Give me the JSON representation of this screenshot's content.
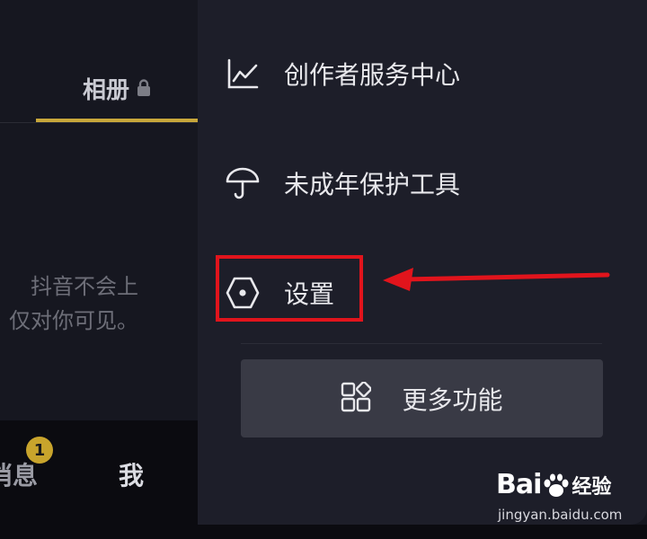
{
  "profile": {
    "tabs": {
      "album_label": "相册"
    },
    "privacy_notice": {
      "line1": "抖音不会上",
      "line2": "仅对你可见。"
    },
    "bottom_nav": {
      "messages_label": "消息",
      "messages_badge": "1",
      "me_label": "我"
    }
  },
  "drawer": {
    "items": [
      {
        "label": "创作者服务中心",
        "icon": "chart-line-icon"
      },
      {
        "label": "未成年保护工具",
        "icon": "umbrella-icon"
      },
      {
        "label": "设置",
        "icon": "hexagon-settings-icon"
      }
    ],
    "more_button": {
      "label": "更多功能",
      "icon": "grid-apps-icon"
    }
  },
  "annotation": {
    "color": "#e1141c"
  },
  "watermark": {
    "brand": "Bai",
    "brand2": "经验",
    "site": "jingyan.baidu.com"
  },
  "colors": {
    "accent": "#c8a73b",
    "drawer_bg": "#1d1e29",
    "highlight": "#e1141c"
  }
}
